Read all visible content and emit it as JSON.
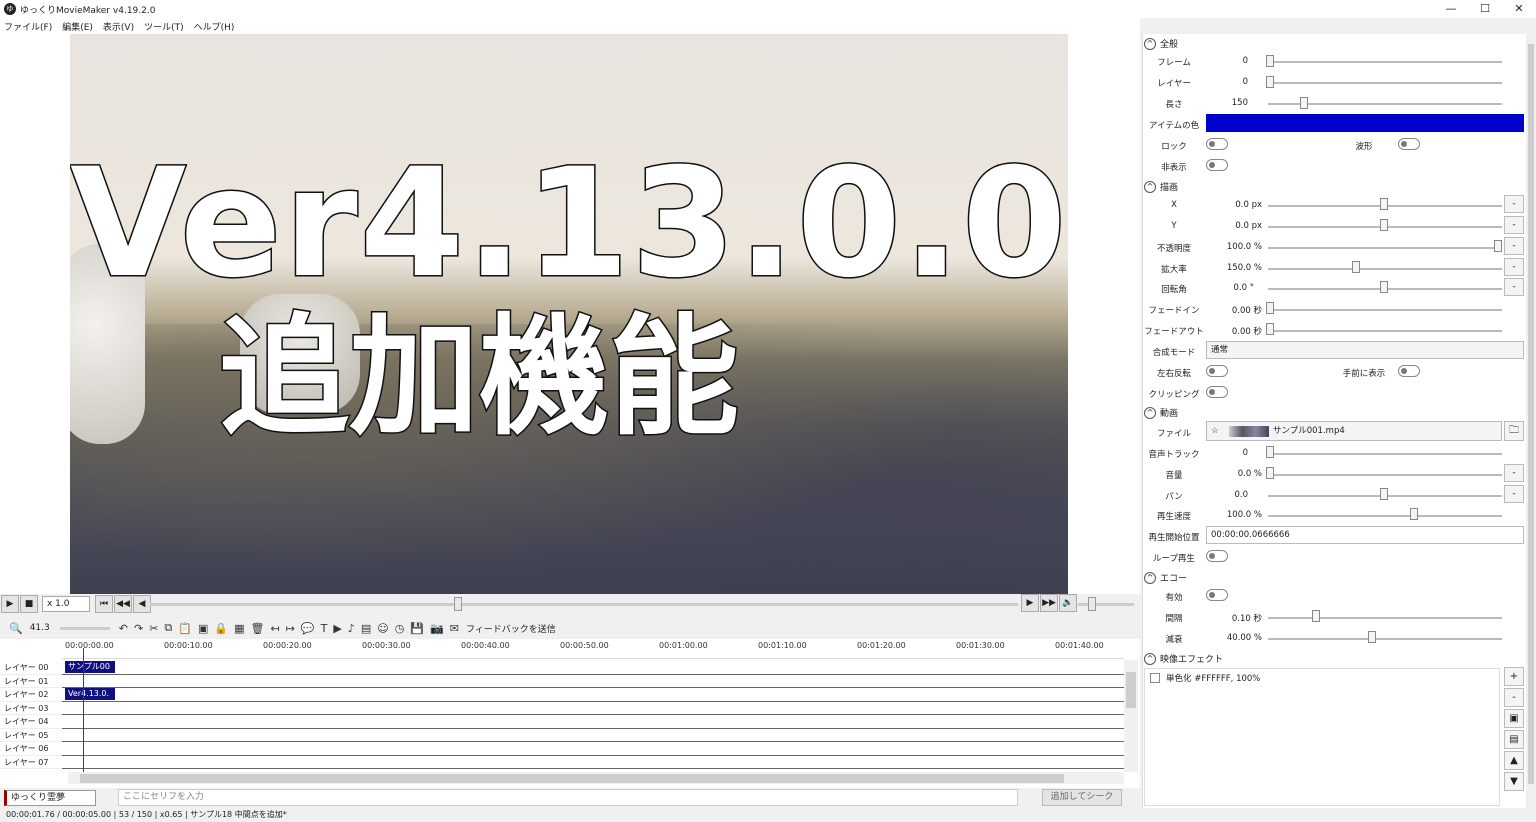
{
  "window": {
    "title": "ゆっくりMovieMaker v4.19.2.0",
    "icon_glyph": "ゆ",
    "min": "—",
    "max": "☐",
    "close": "✕"
  },
  "menu": [
    "ファイル(F)",
    "編集(E)",
    "表示(V)",
    "ツール(T)",
    "ヘルプ(H)"
  ],
  "preview": {
    "line1": "Ver4.13.0.0",
    "line2": "追加機能"
  },
  "transport": {
    "speed": "x 1.0"
  },
  "toolbar": {
    "zoom": "41.3",
    "feedback": "フィードバックを送信"
  },
  "timeline": {
    "ticks": [
      "00:00:00.00",
      "00:00:10.00",
      "00:00:20.00",
      "00:00:30.00",
      "00:00:40.00",
      "00:00:50.00",
      "00:01:00.00",
      "00:01:10.00",
      "00:01:20.00",
      "00:01:30.00",
      "00:01:40.00"
    ],
    "layers": [
      "レイヤー 00",
      "レイヤー 01",
      "レイヤー 02",
      "レイヤー 03",
      "レイヤー 04",
      "レイヤー 05",
      "レイヤー 06",
      "レイヤー 07"
    ],
    "clip_video": "サンプル00",
    "clip_text": "Ver4.13.0."
  },
  "speaker": {
    "character": "ゆっくり霊夢",
    "placeholder": "ここにセリフを入力",
    "add_button": "追加してシーク"
  },
  "status": "00:00:01.76 / 00:00:05.00 | 53 / 150 | x0.65 | サンプル18 中間点を追加*",
  "props": {
    "sec_general": "全般",
    "frame_label": "フレーム",
    "frame_val": "0",
    "layer_label": "レイヤー",
    "layer_val": "0",
    "length_label": "長さ",
    "length_val": "150",
    "itemcolor_label": "アイテムの色",
    "item_color": "#0000cc",
    "lock_label": "ロック",
    "wave_label": "波形",
    "hidden_label": "非表示",
    "sec_draw": "描画",
    "x_label": "X",
    "x_val": "0.0 px",
    "y_label": "Y",
    "y_val": "0.0 px",
    "opacity_label": "不透明度",
    "opacity_val": "100.0 %",
    "scale_label": "拡大率",
    "scale_val": "150.0 %",
    "rot_label": "回転角",
    "rot_val": "0.0 °",
    "fadein_label": "フェードイン",
    "fadein_val": "0.00 秒",
    "fadeout_label": "フェードアウト",
    "fadeout_val": "0.00 秒",
    "blend_label": "合成モード",
    "blend_val": "通常",
    "flip_label": "左右反転",
    "front_label": "手前に表示",
    "clip_label": "クリッピング",
    "sec_video": "動画",
    "file_label": "ファイル",
    "file_val": "サンプル001.mp4",
    "audiotrack_label": "音声トラック",
    "audiotrack_val": "0",
    "volume_label": "音量",
    "volume_val": "0.0 %",
    "pan_label": "パン",
    "pan_val": "0.0",
    "speed_label": "再生速度",
    "speed_val": "100.0 %",
    "startpos_label": "再生開始位置",
    "startpos_val": "00:00:00.0666666",
    "loop_label": "ループ再生",
    "sec_echo": "エコー",
    "enabled_label": "有効",
    "interval_label": "間隔",
    "interval_val": "0.10 秒",
    "decay_label": "減衰",
    "decay_val": "40.00 %",
    "sec_effect": "映像エフェクト",
    "effect_item": "単色化 #FFFFFF, 100%"
  },
  "icons": {
    "minus": "-",
    "folder": "🗀",
    "star": "☆",
    "plus": "+",
    "up": "▲",
    "down": "▼"
  }
}
